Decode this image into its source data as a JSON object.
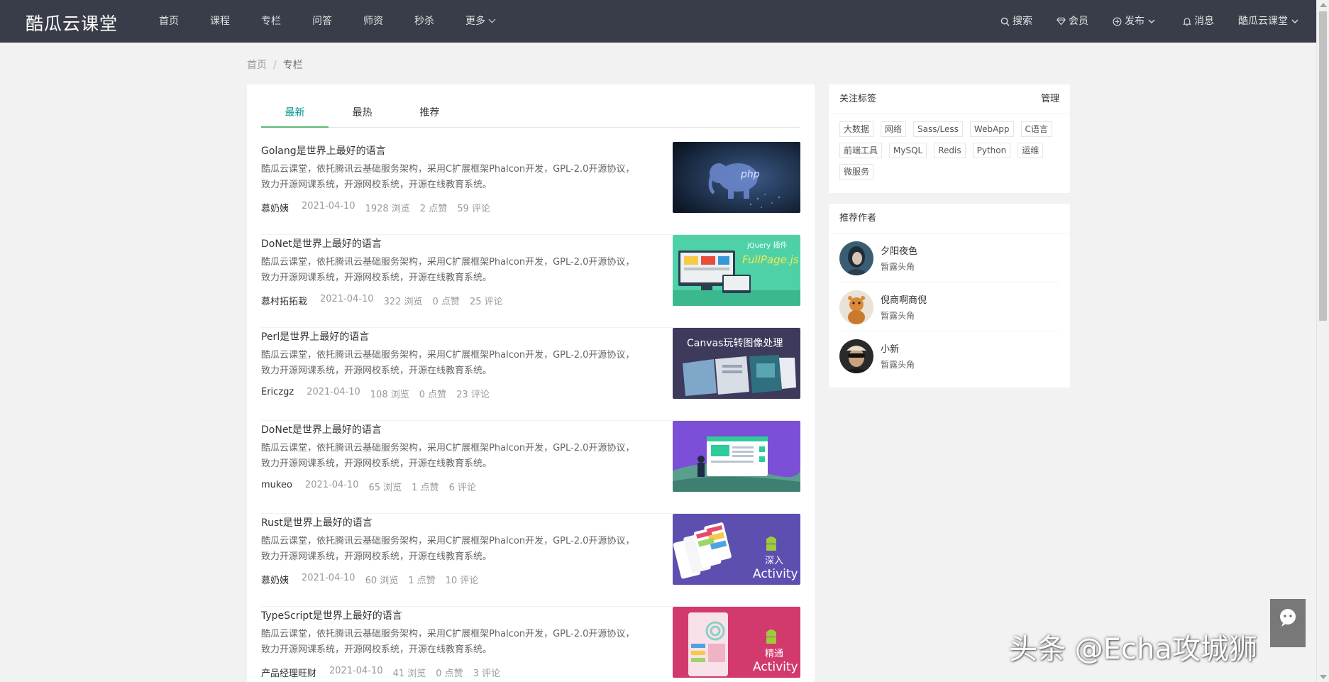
{
  "header": {
    "logo": "酷瓜云课堂",
    "nav": [
      {
        "label": "首页"
      },
      {
        "label": "课程"
      },
      {
        "label": "专栏"
      },
      {
        "label": "问答"
      },
      {
        "label": "师资"
      },
      {
        "label": "秒杀"
      },
      {
        "label": "更多"
      }
    ],
    "right": {
      "search": "搜索",
      "vip": "会员",
      "publish": "发布",
      "message": "消息",
      "user": "酷瓜云课堂"
    }
  },
  "breadcrumb": {
    "home": "首页",
    "separator": "/",
    "current": "专栏"
  },
  "tabs": [
    {
      "label": "最新",
      "active": true
    },
    {
      "label": "最热",
      "active": false
    },
    {
      "label": "推荐",
      "active": false
    }
  ],
  "articles": [
    {
      "title": "Golang是世界上最好的语言",
      "summary_line1": "酷瓜云课堂，依托腾讯云基础服务架构，采用C扩展框架Phalcon开发，GPL-2.0开源协议，",
      "summary_line2": "致力开源网课系统，开源网校系统，开源在线教育系统。",
      "author": "慕奶姨",
      "date": "2021-04-10",
      "views": "1928 浏览",
      "likes": "2 点赞",
      "comments": "59 评论",
      "cover_text": "php"
    },
    {
      "title": "DoNet是世界上最好的语言",
      "summary_line1": "酷瓜云课堂，依托腾讯云基础服务架构，采用C扩展框架Phalcon开发，GPL-2.0开源协议，",
      "summary_line2": "致力开源网课系统，开源网校系统，开源在线教育系统。",
      "author": "慕村拓拓栽",
      "date": "2021-04-10",
      "views": "322 浏览",
      "likes": "0 点赞",
      "comments": "25 评论",
      "cover_text": "jQuery 插件",
      "cover_text2": "FullPage.js"
    },
    {
      "title": "Perl是世界上最好的语言",
      "summary_line1": "酷瓜云课堂，依托腾讯云基础服务架构，采用C扩展框架Phalcon开发，GPL-2.0开源协议，",
      "summary_line2": "致力开源网课系统，开源网校系统，开源在线教育系统。",
      "author": "Ericzgz",
      "date": "2021-04-10",
      "views": "108 浏览",
      "likes": "0 点赞",
      "comments": "23 评论",
      "cover_text": "Canvas玩转图像处理"
    },
    {
      "title": "DoNet是世界上最好的语言",
      "summary_line1": "酷瓜云课堂，依托腾讯云基础服务架构，采用C扩展框架Phalcon开发，GPL-2.0开源协议，",
      "summary_line2": "致力开源网课系统，开源网校系统，开源在线教育系统。",
      "author": "mukeo",
      "date": "2021-04-10",
      "views": "65 浏览",
      "likes": "1 点赞",
      "comments": "6 评论",
      "cover_text": ""
    },
    {
      "title": "Rust是世界上最好的语言",
      "summary_line1": "酷瓜云课堂，依托腾讯云基础服务架构，采用C扩展框架Phalcon开发，GPL-2.0开源协议，",
      "summary_line2": "致力开源网课系统，开源网校系统，开源在线教育系统。",
      "author": "慕奶姨",
      "date": "2021-04-10",
      "views": "60 浏览",
      "likes": "1 点赞",
      "comments": "10 评论",
      "cover_text": "深入",
      "cover_text2": "Activity"
    },
    {
      "title": "TypeScript是世界上最好的语言",
      "summary_line1": "酷瓜云课堂，依托腾讯云基础服务架构，采用C扩展框架Phalcon开发，GPL-2.0开源协议，",
      "summary_line2": "致力开源网课系统，开源网校系统，开源在线教育系统。",
      "author": "产品经理旺财",
      "date": "2021-04-10",
      "views": "41 浏览",
      "likes": "0 点赞",
      "comments": "3 评论",
      "cover_text": "精通",
      "cover_text2": "Activity"
    }
  ],
  "sidebar": {
    "tags_title": "关注标签",
    "manage": "管理",
    "tags": [
      "大数据",
      "网络",
      "Sass/Less",
      "WebApp",
      "C语言",
      "前端工具",
      "MySQL",
      "Redis",
      "Python",
      "运维",
      "微服务"
    ],
    "authors_title": "推荐作者",
    "authors": [
      {
        "name": "夕阳夜色",
        "title": "暂露头角"
      },
      {
        "name": "倪商啊商倪",
        "title": "暂露头角"
      },
      {
        "name": "小新",
        "title": "暂露头角"
      }
    ]
  },
  "watermark": "头条 @Echa攻城狮",
  "colors": {
    "header_bg": "#393d49",
    "active_tab": "#009688",
    "tab_underline": "#5fb878",
    "page_bg": "#f2f2f2"
  }
}
